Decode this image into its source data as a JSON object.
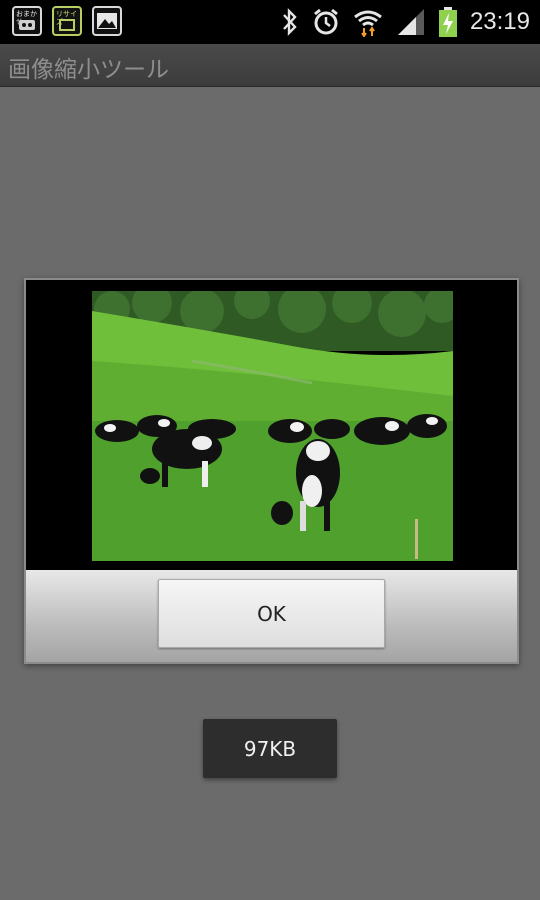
{
  "status_bar": {
    "time": "23:19",
    "notification_icons": [
      "app-notification-icon",
      "app-notification-icon-green",
      "image-icon"
    ],
    "notification_icon_text": [
      "おまかせ",
      "リサイズ"
    ],
    "system_icons": [
      "bluetooth-icon",
      "alarm-icon",
      "wifi-icon",
      "signal-icon",
      "battery-charging-icon"
    ],
    "colors": {
      "battery": "#8fd14f",
      "wifi_arrows": "#f0a028"
    }
  },
  "app_bar": {
    "title": "画像縮小ツール"
  },
  "dialog": {
    "image_description_icon": "photo-cows-grazing",
    "ok_label": "OK"
  },
  "size_label": "97KB"
}
